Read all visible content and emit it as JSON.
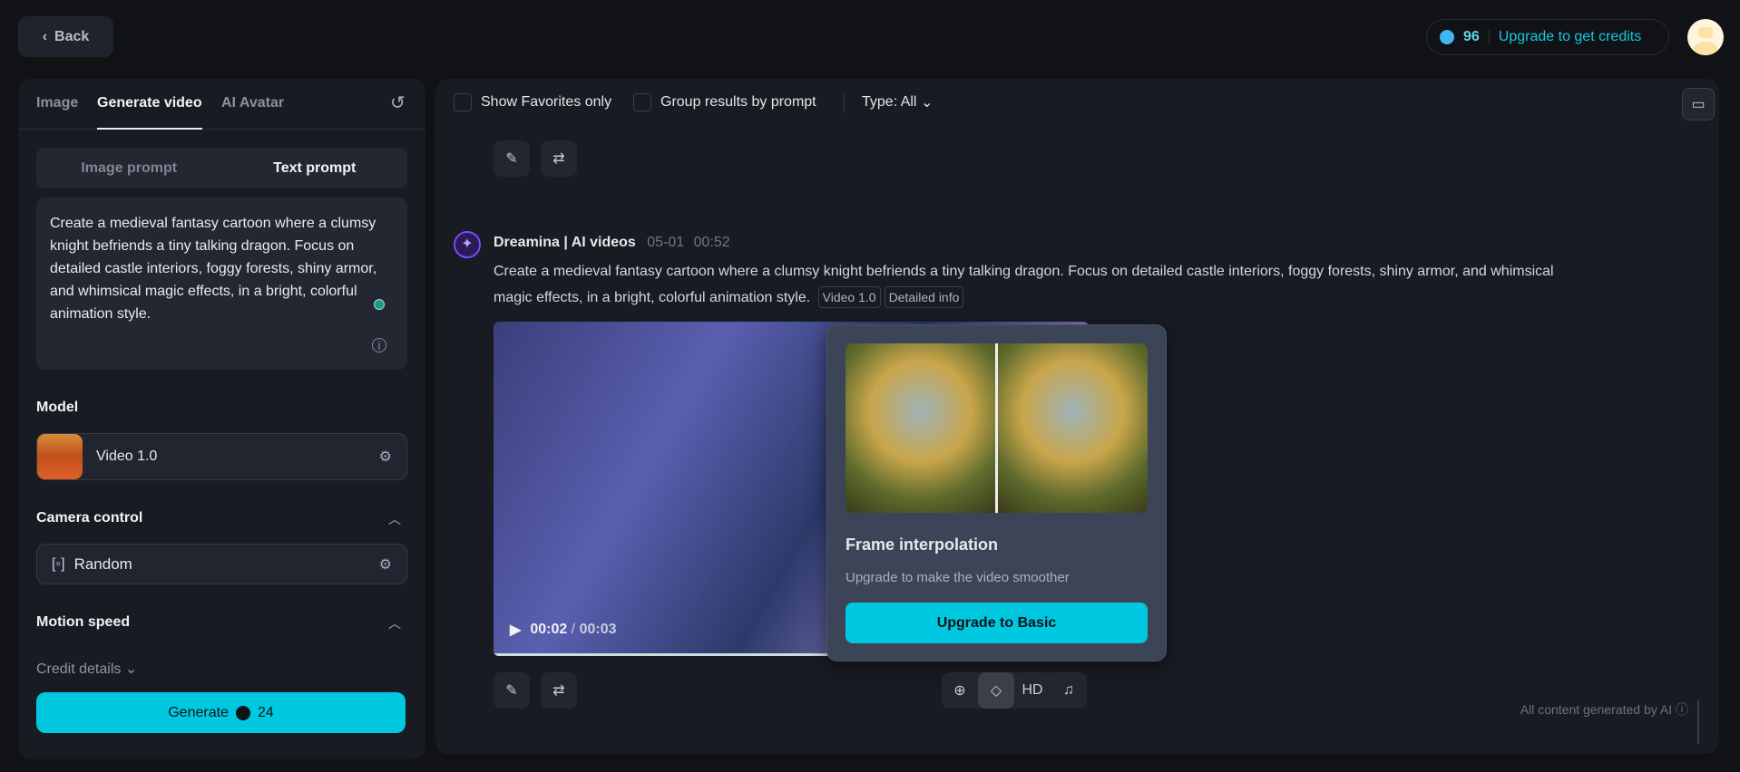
{
  "header": {
    "back_label": "Back",
    "credits": "96",
    "upgrade_label": "Upgrade to get credits"
  },
  "left": {
    "tabs": [
      "Image",
      "Generate video",
      "AI Avatar"
    ],
    "prompt_modes": [
      "Image prompt",
      "Text prompt"
    ],
    "prompt_text": "Create a medieval fantasy cartoon where a clumsy knight befriends a tiny talking dragon. Focus on detailed castle interiors, foggy forests, shiny armor, and whimsical magic effects, in a bright, colorful animation style.",
    "model_label": "Model",
    "model_value": "Video 1.0",
    "camera_label": "Camera control",
    "camera_value": "Random",
    "motion_label": "Motion speed",
    "credit_details": "Credit details",
    "generate_label": "Generate",
    "generate_cost": "24"
  },
  "main": {
    "toolbar": {
      "favorites": "Show Favorites only",
      "group": "Group results by prompt",
      "type": "Type: All"
    },
    "post": {
      "author": "Dreamina | AI videos",
      "date": "05-01",
      "time": "00:52",
      "prompt": "Create a medieval fantasy cartoon where a clumsy knight befriends a tiny talking dragon. Focus on detailed castle interiors, foggy forests, shiny armor, and whimsical magic effects, in a bright, colorful animation style.",
      "tags": [
        "Video 1.0",
        "Detailed info"
      ],
      "current_time": "00:02",
      "duration": "00:03",
      "progress": 0.67
    },
    "popover": {
      "title": "Frame interpolation",
      "subtitle": "Upgrade to make the video smoother",
      "button": "Upgrade to Basic"
    },
    "tools": {
      "hd": "HD"
    },
    "footer": "All content generated by AI"
  }
}
